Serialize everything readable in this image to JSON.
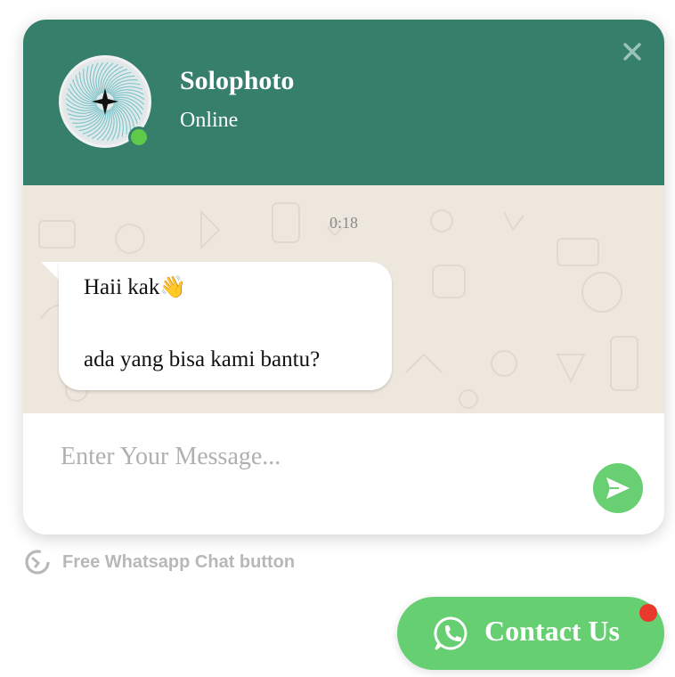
{
  "header": {
    "name": "Solophoto",
    "status": "Online"
  },
  "chat": {
    "timestamp": "0:18",
    "message_line1": "Haii kak",
    "message_emoji": "👋",
    "message_line2": "ada yang bisa kami bantu?"
  },
  "composer": {
    "placeholder": "Enter Your Message..."
  },
  "footer": {
    "credit": "Free Whatsapp Chat button"
  },
  "contact_button": {
    "label": "Contact Us"
  },
  "colors": {
    "header_bg": "#367f6a",
    "chat_bg": "#eee7de",
    "accent_green": "#66cf72",
    "online_dot": "#5fca4a",
    "notification_badge": "#e8392b"
  },
  "icons": {
    "close": "close-icon",
    "send": "send-icon",
    "whatsapp": "whatsapp-icon",
    "credit": "refresh-like-icon"
  }
}
